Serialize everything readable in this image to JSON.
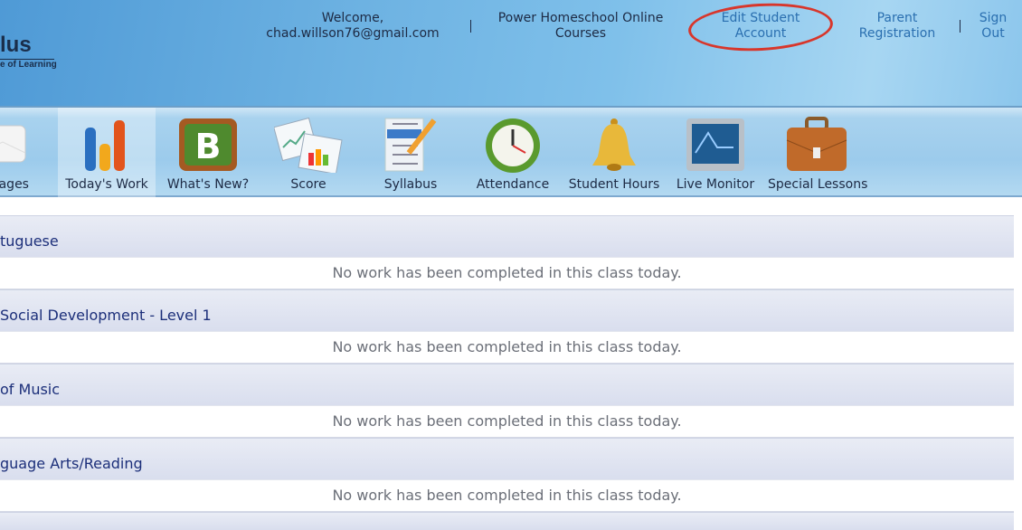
{
  "header": {
    "logo_text": "lus",
    "logo_sub": "e of Learning",
    "welcome": "Welcome,",
    "email": "chad.willson76@gmail.com",
    "links": [
      {
        "l1": "Power Homeschool Online",
        "l2": "Courses"
      },
      {
        "l1": "Edit Student",
        "l2": "Account"
      },
      {
        "l1": "Parent",
        "l2": "Registration"
      },
      {
        "l1": "Sign",
        "l2": "Out"
      }
    ],
    "annotation_color": "#d8362b"
  },
  "nav": {
    "items": [
      {
        "label": "ssages",
        "icon": "envelope-icon"
      },
      {
        "label": "Today's Work",
        "icon": "bar-chart-icon",
        "active": true
      },
      {
        "label": "What's New?",
        "icon": "blog-icon"
      },
      {
        "label": "Score",
        "icon": "calendar-chart-icon"
      },
      {
        "label": "Syllabus",
        "icon": "checklist-pencil-icon"
      },
      {
        "label": "Attendance",
        "icon": "clock-icon"
      },
      {
        "label": "Student Hours",
        "icon": "bell-icon"
      },
      {
        "label": "Live Monitor",
        "icon": "monitor-icon"
      },
      {
        "label": "Special Lessons",
        "icon": "briefcase-icon"
      }
    ]
  },
  "classes": [
    {
      "name": "tuguese",
      "status": "No work has been completed in this class today."
    },
    {
      "name": "Social Development - Level 1",
      "status": "No work has been completed in this class today."
    },
    {
      "name": "of Music",
      "status": "No work has been completed in this class today."
    },
    {
      "name": "guage Arts/Reading",
      "status": "No work has been completed in this class today."
    }
  ]
}
